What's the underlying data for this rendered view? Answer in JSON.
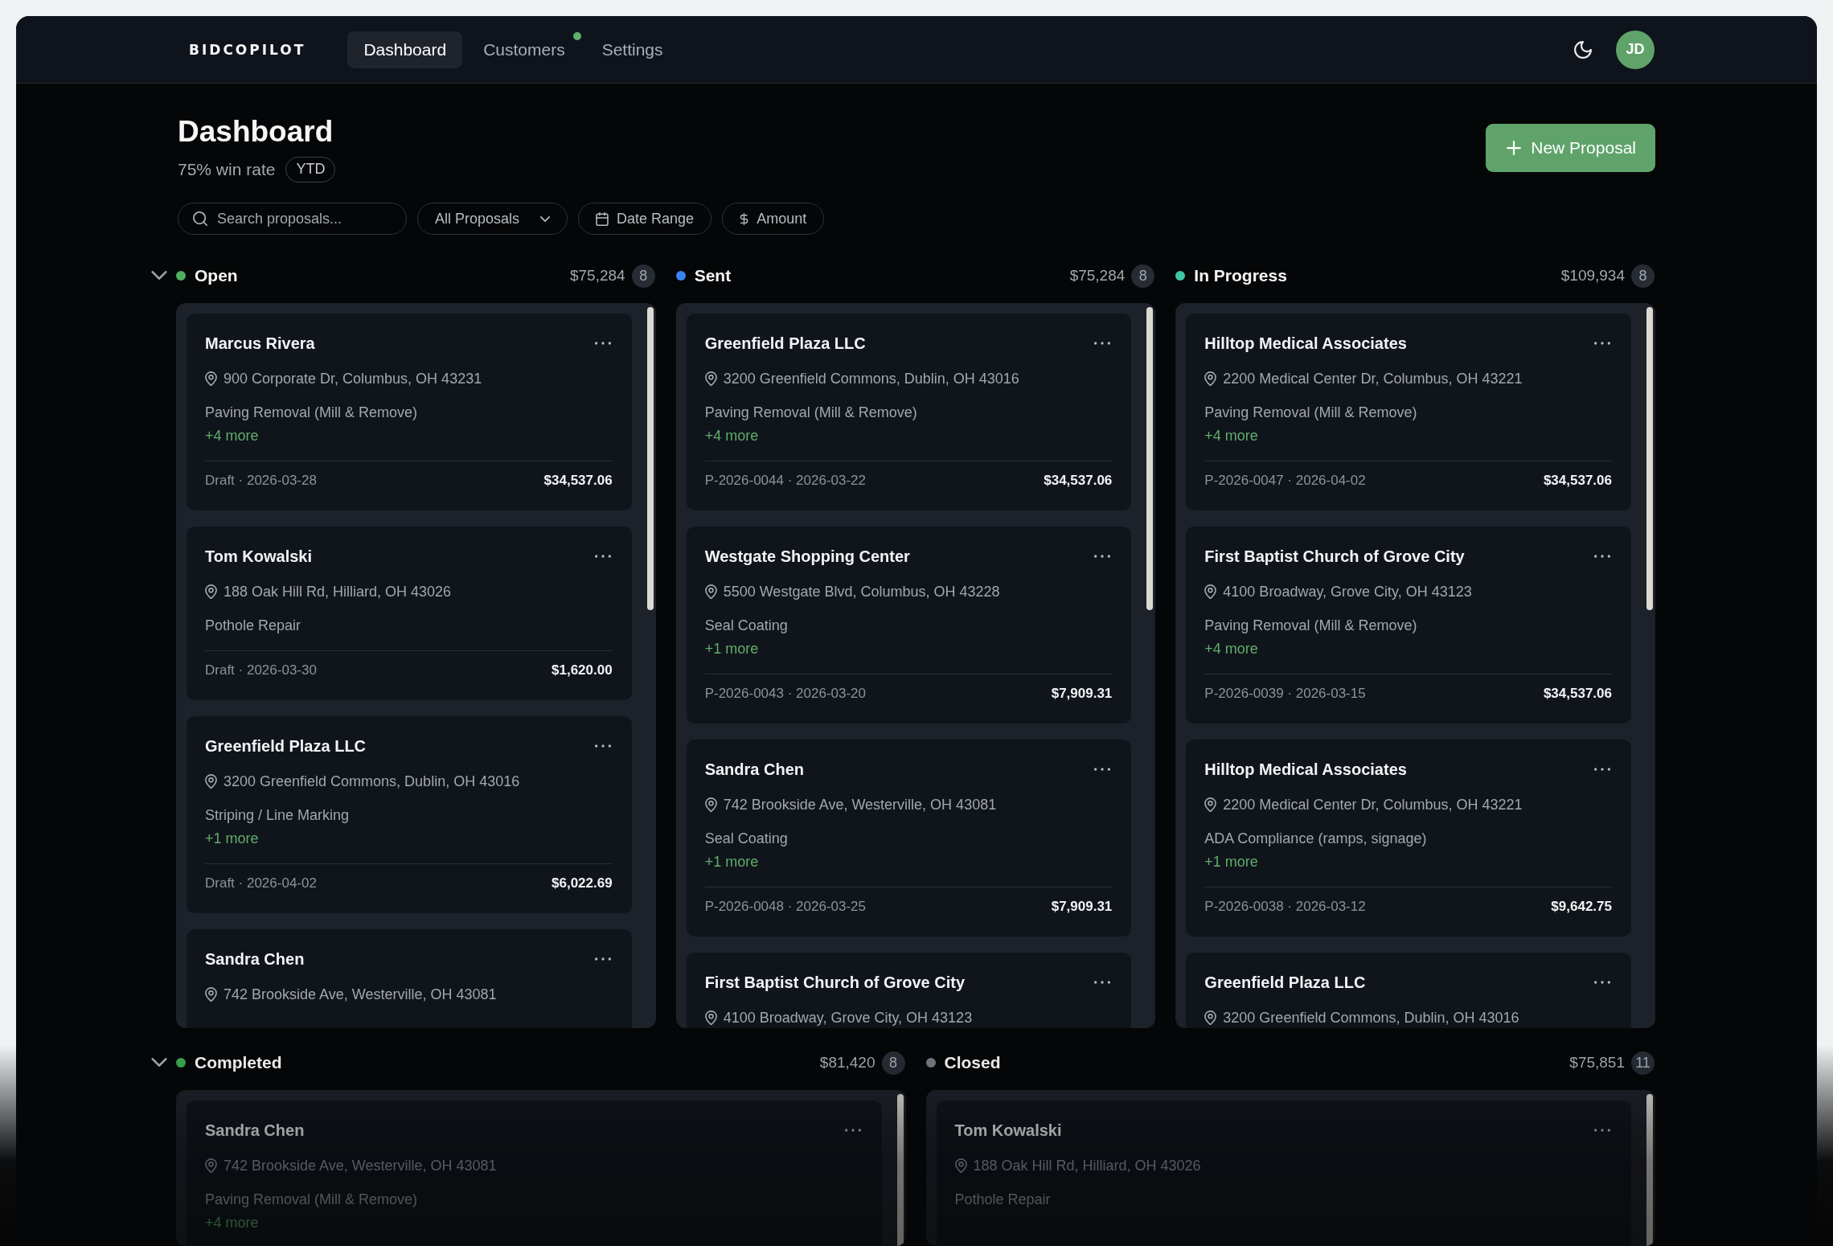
{
  "nav": {
    "logo": "BIDCOPILOT",
    "tabs": [
      {
        "label": "Dashboard",
        "selected": true,
        "notification": false
      },
      {
        "label": "Customers",
        "selected": false,
        "notification": true
      },
      {
        "label": "Settings",
        "selected": false,
        "notification": false
      }
    ],
    "avatar": "JD"
  },
  "header": {
    "title": "Dashboard",
    "win_rate": "75% win rate",
    "period": "YTD",
    "action": "New Proposal"
  },
  "filters": {
    "search": {
      "placeholder": "Search proposals..."
    },
    "items": [
      {
        "kind": "dropdown",
        "label": "All Proposals"
      },
      {
        "kind": "date",
        "label": "Date Range"
      },
      {
        "kind": "amount",
        "label": "Amount"
      }
    ]
  },
  "sections": [
    {
      "expanded": true,
      "columns": [
        {
          "title": "Open",
          "color": "#4fb062",
          "total": "$75,284",
          "count": "8",
          "cards": [
            {
              "name": "Marcus Rivera",
              "address": "900 Corporate Dr, Columbus, OH 43231",
              "service": "Paving Removal (Mill & Remove)",
              "more": "+4 more",
              "meta": "Draft · 2026-03-28",
              "amount": "$34,537.06"
            },
            {
              "name": "Tom Kowalski",
              "address": "188 Oak Hill Rd, Hilliard, OH 43026",
              "service": "Pothole Repair",
              "meta": "Draft · 2026-03-30",
              "amount": "$1,620.00"
            },
            {
              "name": "Greenfield Plaza LLC",
              "address": "3200 Greenfield Commons, Dublin, OH 43016",
              "service": "Striping / Line Marking",
              "more": "+1 more",
              "meta": "Draft · 2026-04-02",
              "amount": "$6,022.69"
            },
            {
              "name": "Sandra Chen",
              "address": "742 Brookside Ave, Westerville, OH 43081"
            }
          ]
        },
        {
          "title": "Sent",
          "color": "#3b82f6",
          "total": "$75,284",
          "count": "8",
          "cards": [
            {
              "name": "Greenfield Plaza LLC",
              "address": "3200 Greenfield Commons, Dublin, OH 43016",
              "service": "Paving Removal (Mill & Remove)",
              "more": "+4 more",
              "meta": "P-2026-0044 · 2026-03-22",
              "amount": "$34,537.06"
            },
            {
              "name": "Westgate Shopping Center",
              "address": "5500 Westgate Blvd, Columbus, OH 43228",
              "service": "Seal Coating",
              "more": "+1 more",
              "meta": "P-2026-0043 · 2026-03-20",
              "amount": "$7,909.31"
            },
            {
              "name": "Sandra Chen",
              "address": "742 Brookside Ave, Westerville, OH 43081",
              "service": "Seal Coating",
              "more": "+1 more",
              "meta": "P-2026-0048 · 2026-03-25",
              "amount": "$7,909.31"
            },
            {
              "name": "First Baptist Church of Grove City",
              "address": "4100 Broadway, Grove City, OH 43123"
            }
          ]
        },
        {
          "title": "In Progress",
          "color": "#3cc6a2",
          "total": "$109,934",
          "count": "8",
          "cards": [
            {
              "name": "Hilltop Medical Associates",
              "address": "2200 Medical Center Dr, Columbus, OH 43221",
              "service": "Paving Removal (Mill & Remove)",
              "more": "+4 more",
              "meta": "P-2026-0047 · 2026-04-02",
              "amount": "$34,537.06"
            },
            {
              "name": "First Baptist Church of Grove City",
              "address": "4100 Broadway, Grove City, OH 43123",
              "service": "Paving Removal (Mill & Remove)",
              "more": "+4 more",
              "meta": "P-2026-0039 · 2026-03-15",
              "amount": "$34,537.06"
            },
            {
              "name": "Hilltop Medical Associates",
              "address": "2200 Medical Center Dr, Columbus, OH 43221",
              "service": "ADA Compliance (ramps, signage)",
              "more": "+1 more",
              "meta": "P-2026-0038 · 2026-03-12",
              "amount": "$9,642.75"
            },
            {
              "name": "Greenfield Plaza LLC",
              "address": "3200 Greenfield Commons, Dublin, OH 43016"
            }
          ]
        }
      ]
    },
    {
      "expanded": true,
      "columns": [
        {
          "title": "Completed",
          "color": "#38a551",
          "total": "$81,420",
          "count": "8",
          "cards": [
            {
              "name": "Sandra Chen",
              "address": "742 Brookside Ave, Westerville, OH 43081",
              "service": "Paving Removal (Mill & Remove)",
              "more": "+4 more"
            }
          ]
        },
        {
          "title": "Closed",
          "color": "#73787f",
          "total": "$75,851",
          "count": "11",
          "cards": [
            {
              "name": "Tom Kowalski",
              "address": "188 Oak Hill Rd, Hilliard, OH 43026",
              "service": "Pothole Repair"
            }
          ]
        }
      ]
    }
  ]
}
